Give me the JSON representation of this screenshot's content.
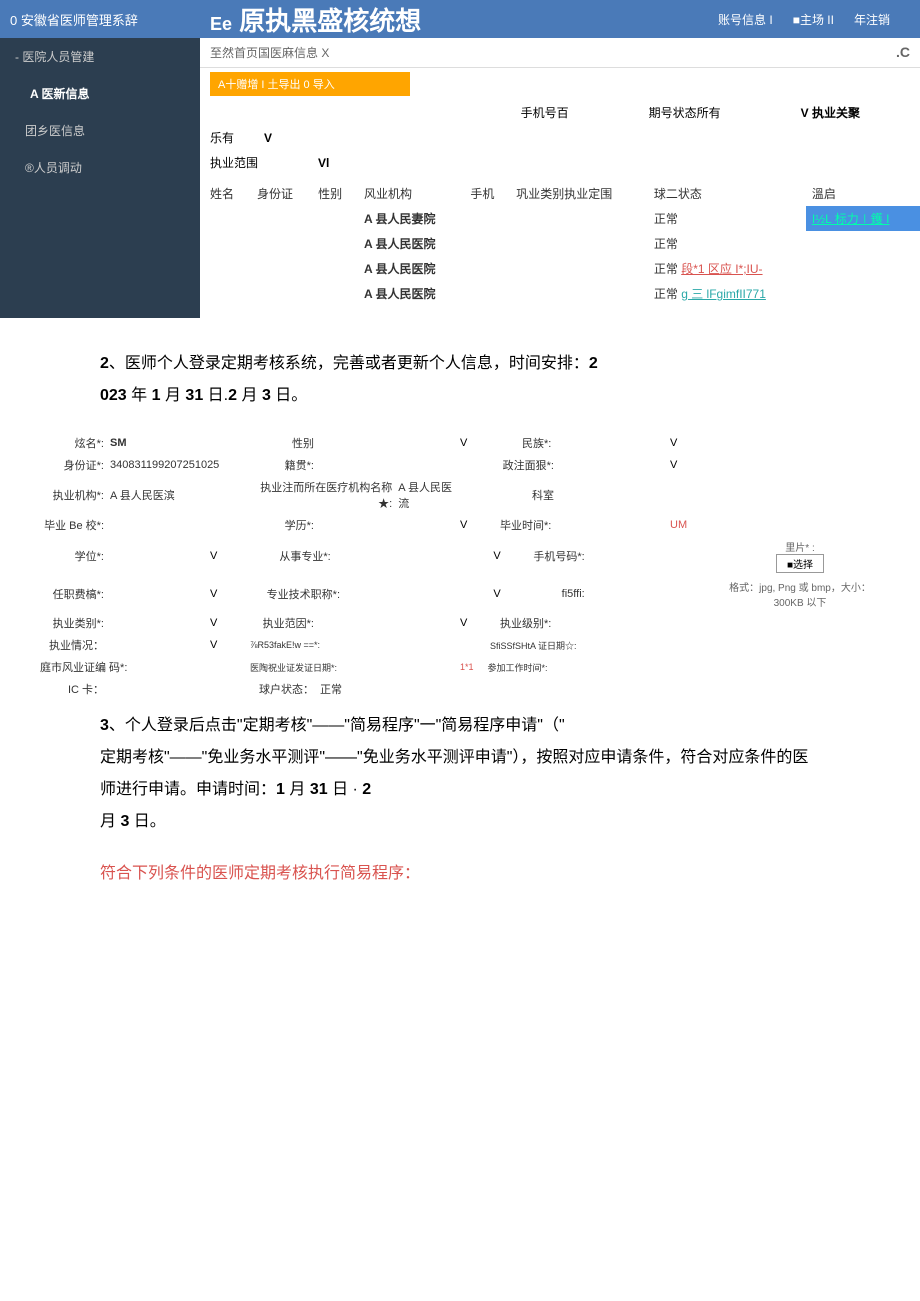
{
  "header": {
    "system_label": "0 安徽省医师管理系辞",
    "title_prefix": "Ee",
    "title": "原执黑盛核统想",
    "account_info": "账号信息 I",
    "home": "■主场 II",
    "logout": "年注销"
  },
  "sidebar": {
    "items": [
      {
        "label": "- 医院人员管建",
        "type": "header"
      },
      {
        "label": "A 医新信息",
        "type": "active"
      },
      {
        "label": "团乡医信息",
        "type": "sub"
      },
      {
        "label": "®人员调动",
        "type": "sub"
      }
    ]
  },
  "tabs": {
    "tab1": "至然首页国医麻信息 X",
    "close": ".C"
  },
  "toolbar": {
    "label": "A十赠增 I 土导出 0 导入"
  },
  "filters": {
    "row1": {
      "phone_label": "手机号百",
      "period_label": "期号状态所有",
      "relation_label": "V 执业关聚"
    },
    "row2": {
      "has_label": "乐有",
      "has_value": "V"
    },
    "row3": {
      "scope_label": "执业范围",
      "scope_value": "Vl"
    }
  },
  "table": {
    "headers": [
      "姓名",
      "身份证",
      "性别",
      "风业机构",
      "手机",
      "巩业类别执业定围",
      "球二状态",
      "溫启"
    ],
    "rows": [
      {
        "org": "A 县人民妻院",
        "status": "正常",
        "action": "I½L 标力∣鑊 I",
        "highlighted": true
      },
      {
        "org": "A 县人民医院",
        "status": "正常",
        "action": ""
      },
      {
        "org": "A 县人民医院",
        "status": "正常",
        "action": "段*1 区应 I*;IU-"
      },
      {
        "org": "A 县人民医院",
        "status": "正常",
        "action": "g 三 lFgimfII771"
      }
    ]
  },
  "section2": {
    "prefix": "2",
    "text1": "、医师个人登录定期考核系统，完善或者更新个人信息，时间安排：",
    "text1_bold": "2",
    "text2_bold": "023",
    "text2": " 年 ",
    "text2_b2": "1",
    "text2_b3": " 月 ",
    "text2_b4": "31",
    "text2_b5": " 日.",
    "text2_b6": "2",
    "text2_b7": " 月 ",
    "text2_b8": "3",
    "text2_b9": " 日。"
  },
  "form": {
    "name_label": "炫名*:",
    "name_value": "SM",
    "gender_label": "性别",
    "ethnicity_label": "民族*:",
    "id_label": "身份证*:",
    "id_value": "340831199207251025",
    "native_label": "籍贯*:",
    "political_label": "政注面狠*:",
    "org_label": "执业机构*:",
    "org_value": "A 县人民医滨",
    "inst_label": "执业注而所在医疗机构名称 ★:",
    "inst_value": "A 县人民医流",
    "dept_label": "科室",
    "school_label": "毕业 Be 校*:",
    "edu_label": "学历*:",
    "grad_time_label": "毕业时间*:",
    "grad_time_value": "UM",
    "degree_label": "学位*:",
    "major_label": "从事专业*:",
    "phone_label": "手机号码*:",
    "photo_label": "里片* :",
    "select_btn": "■选择",
    "title_label": "任职费槁*:",
    "tech_title_label": "专业技术职称*:",
    "fi5ffi_label": "fi5ffi:",
    "format_hint": "格式：jpg, Png 或 bmp，大小：300KB 以下",
    "category_label": "执业类别*:",
    "scope_label": "执业范因*:",
    "level_label": "执业级别*:",
    "situation_label": "执业情况：",
    "date_small": "⅞R53fakE!w ==*:",
    "cert_date_label": "SfiSSfSHtA 证日期☆:",
    "cert_no_label": "庭市风业证编 码*:",
    "issue_label": "医陶祝业证发证日期*:",
    "work_time_label": "参加工作时间*:",
    "ic_label": "IC 卡：",
    "account_status_label": "球户状态：",
    "account_status_value": "正常",
    "v": "V",
    "one_star": "1*1"
  },
  "section3": {
    "prefix": "3",
    "text1": "、个人登录后点击\"定期考核\"——\"简易程序\"一\"简易程序申请\"（\"",
    "text2": "定期考核\"——\"免业务水平测评\"——\"免业务水平测评申请\"），按照对应申请条件，符合对应条件的医师进行申请。申请时间：",
    "text2_b1": "1",
    "text2_m1": " 月 ",
    "text2_b2": "31",
    "text2_m2": " 日 · ",
    "text2_b3": "2",
    "text3": "月 ",
    "text3_b1": "3",
    "text3_m1": " 日。",
    "red_line": "符合下列条件的医师定期考核执行简易程序："
  }
}
